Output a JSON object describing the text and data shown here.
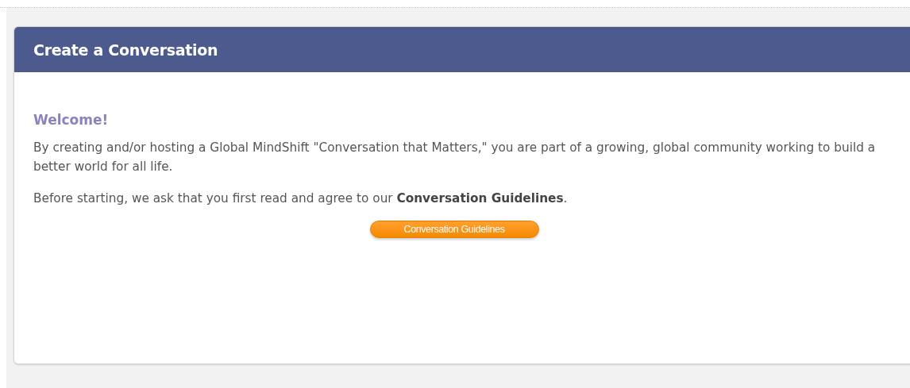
{
  "panel": {
    "title": "Create a Conversation"
  },
  "welcome": "Welcome!",
  "paragraphs": [
    "By creating and/or hosting a Global MindShift \"Conversation that Matters,\" you are part of a growing, global community working to build a better world for all life.",
    "Before starting, we ask that you first read and agree to our **Conversation Guidelines**."
  ],
  "button": "Conversation Guidelines"
}
